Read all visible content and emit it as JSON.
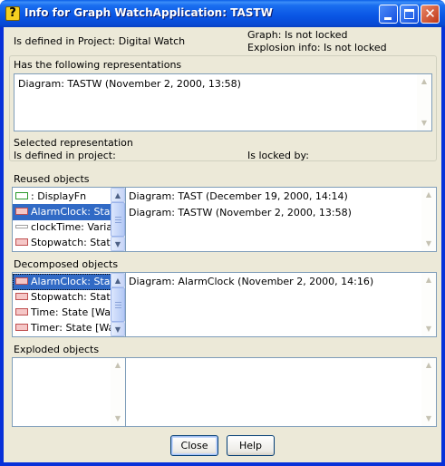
{
  "window": {
    "title": "Info for Graph WatchApplication: TASTW",
    "app_icon_glyph": "?"
  },
  "info": {
    "defined_in_project": "Is defined in Project: Digital Watch",
    "graph_lock": "Graph: Is not locked",
    "explosion_lock": "Explosion info: Is not locked"
  },
  "representations": {
    "label": "Has the following representations",
    "items": [
      "Diagram: TASTW (November 2, 2000, 13:58)"
    ],
    "selected_label": "Selected representation",
    "defined_in_project_label": "Is defined in project:",
    "locked_by_label": "Is locked by:"
  },
  "reused": {
    "label": "Reused objects",
    "objects": [
      {
        "text": ": DisplayFn",
        "icon": "green"
      },
      {
        "text": "AlarmClock: State",
        "icon": "red",
        "selected": true
      },
      {
        "text": "clockTime: Variable",
        "icon": "gray"
      },
      {
        "text": "Stopwatch: State",
        "icon": "red"
      }
    ],
    "diagrams": [
      "Diagram: TAST (December 19, 2000, 14:14)",
      "Diagram: TASTW (November 2, 2000, 13:58)"
    ]
  },
  "decomposed": {
    "label": "Decomposed objects",
    "objects": [
      {
        "text": "AlarmClock: State",
        "icon": "red",
        "selected": true
      },
      {
        "text": "Stopwatch: State",
        "icon": "red"
      },
      {
        "text": "Time: State [Watc",
        "icon": "red"
      },
      {
        "text": "Timer: State [Wat",
        "icon": "red"
      }
    ],
    "diagrams": [
      "Diagram: AlarmClock (November 2, 2000, 14:16)"
    ]
  },
  "exploded": {
    "label": "Exploded objects"
  },
  "buttons": {
    "close": "Close",
    "help": "Help"
  },
  "icons": {
    "titlebar": [
      "minimize-icon",
      "maximize-icon",
      "close-icon"
    ],
    "scroll": [
      "scroll-up-arrow-icon",
      "scroll-down-arrow-icon"
    ],
    "object_types": {
      "green": "#2a9a2a",
      "red": "#c05050",
      "gray": "#a0a0a0"
    }
  },
  "colors": {
    "titlebar": "#0955e4",
    "dialog_bg": "#ece9d8",
    "selection": "#316ac5",
    "list_border": "#7f9db9"
  }
}
